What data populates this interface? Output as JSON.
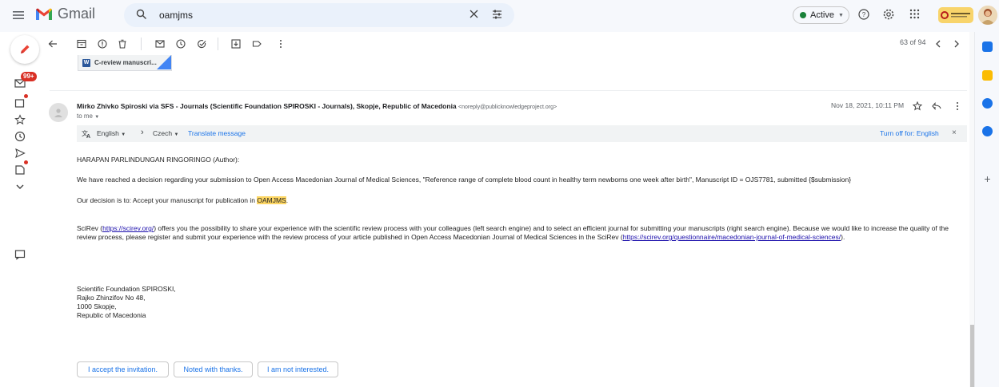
{
  "app": {
    "name": "Gmail"
  },
  "search": {
    "value": "oamjms"
  },
  "header": {
    "active_label": "Active"
  },
  "left_rail": {
    "unread_badge": "99+"
  },
  "toolbar": {
    "pager": "63 of 94"
  },
  "attachment": {
    "name": "C-review manuscri..."
  },
  "email": {
    "sender_name": "Mirko Zhivko Spiroski via SFS - Journals (Scientific Foundation SPIROSKI - Journals), Skopje, Republic of Macedonia",
    "sender_email": "<noreply@publicknowledgeproject.org>",
    "to": "to me",
    "date": "Nov 18, 2021, 10:11 PM"
  },
  "translate": {
    "from": "English",
    "to": "Czech",
    "action": "Translate message",
    "turn_off": "Turn off for: English"
  },
  "body": {
    "greeting": "HARAPAN PARLINDUNGAN RINGORINGO (Author):",
    "para1": "We have reached a decision regarding your submission to Open Access Macedonian Journal of Medical Sciences, \"Reference range of complete blood count in healthy term newborns one week after birth\", Manuscript ID = OJS7781, submitted {$submission}",
    "decision_prefix": "Our decision is to: Accept your manuscript for publication in ",
    "decision_highlight": "OAMJMS",
    "decision_suffix": ".",
    "scirev_link": "https://scirev.org/",
    "scirev_text1": "SciRev (",
    "scirev_text2": ") offers you the possibility to share your experience with the scientific review process with your colleagues (left search engine) and to select an efficient journal for submitting your manuscripts (right search engine). Because we would like to increase the quality of the",
    "scirev_line2_prefix": "review process, please register and submit your experience with the review process of your article published in Open Access Macedonian Journal of Medical Sciences in the SciRev (",
    "scirev_link2": "https://scirev.org/questionnaire/macedonian-journal-of-medical-sciences/",
    "scirev_line2_suffix": ").",
    "sig1": "Scientific Foundation SPIROSKI,",
    "sig2": "Rajko Zhinzifov No 48,",
    "sig3": "1000 Skopje,",
    "sig4": "Republic of Macedonia"
  },
  "smart_replies": [
    "I accept the invitation.",
    "Noted with thanks.",
    "I am not interested."
  ],
  "colors": {
    "accent": "#1a73e8",
    "highlight": "#fdd663",
    "badge": "#d93025"
  }
}
